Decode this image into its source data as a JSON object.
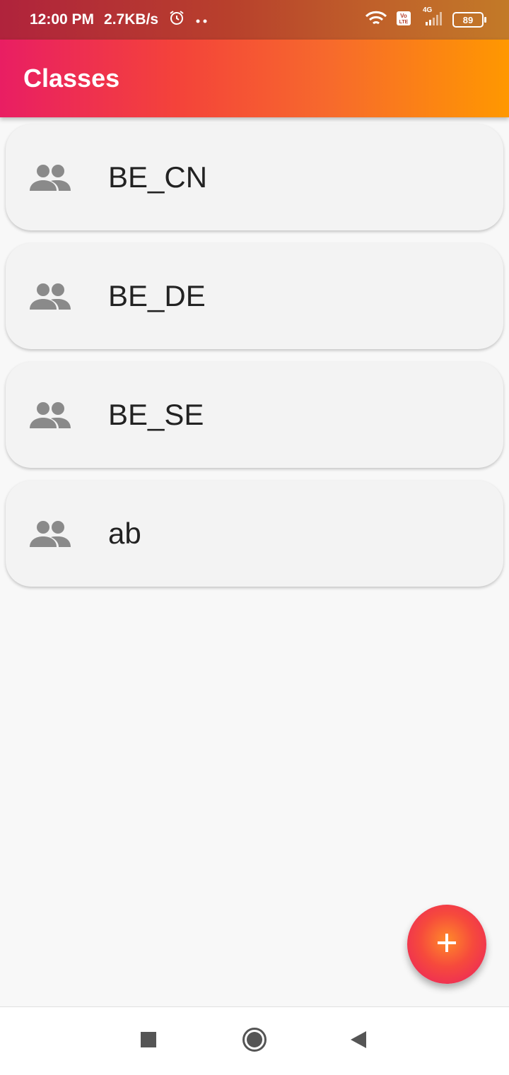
{
  "status_bar": {
    "time": "12:00 PM",
    "speed": "2.7KB/s",
    "network": "4G",
    "battery": "89"
  },
  "app_bar": {
    "title": "Classes"
  },
  "classes": [
    {
      "name": "BE_CN",
      "icon": "people-icon"
    },
    {
      "name": "BE_DE",
      "icon": "people-icon"
    },
    {
      "name": "BE_SE",
      "icon": "people-icon"
    },
    {
      "name": "ab",
      "icon": "people-icon"
    }
  ],
  "fab": {
    "icon": "plus-icon"
  },
  "nav": {
    "recents_icon": "square-icon",
    "home_icon": "circle-icon",
    "back_icon": "triangle-icon"
  },
  "colors": {
    "gradient_start": "#e91e63",
    "gradient_end": "#ff9800",
    "icon_gray": "#8a8a8a"
  }
}
